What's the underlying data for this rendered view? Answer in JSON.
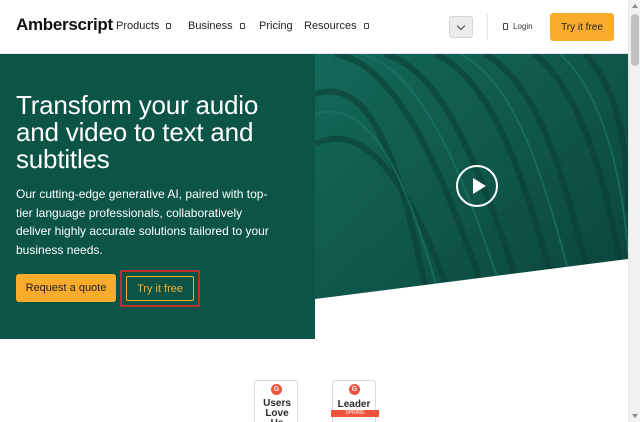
{
  "nav": {
    "logo": "Amberscript",
    "items": [
      {
        "label": "Products",
        "has_dropdown": true
      },
      {
        "label": "Business",
        "has_dropdown": true
      },
      {
        "label": "Pricing",
        "has_dropdown": false
      },
      {
        "label": "Resources",
        "has_dropdown": true
      }
    ],
    "language_icon": "chevron-down-icon",
    "login_label": "Login",
    "cta_label": "Try it free"
  },
  "hero": {
    "title": "Transform your audio and video to text and subtitles",
    "subtitle": "Our cutting-edge generative AI, paired with top-tier language professionals, collaboratively deliver highly accurate solutions tailored to your business needs.",
    "primary_button": "Request a quote",
    "secondary_button": "Try it free",
    "play_icon": "play-icon"
  },
  "badges": [
    {
      "icon_letter": "G",
      "text": "Users Love Us",
      "ribbon": ""
    },
    {
      "icon_letter": "G",
      "text": "Leader",
      "ribbon": "SPRING"
    }
  ],
  "colors": {
    "accent": "#f9ac2c",
    "hero_bg": "#0c5446",
    "highlight_border": "#c0302b",
    "g2_red": "#f0523c"
  }
}
